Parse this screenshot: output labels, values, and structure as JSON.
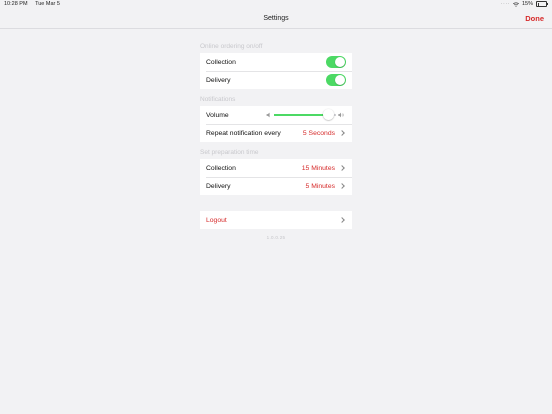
{
  "status_bar": {
    "time": "10:28 PM",
    "date": "Tue Mar 5",
    "battery": "15%"
  },
  "nav": {
    "title": "Settings",
    "done_label": "Done"
  },
  "sections": {
    "ordering": {
      "header": "Online ordering on/off",
      "collection_label": "Collection",
      "collection_on": true,
      "delivery_label": "Delivery",
      "delivery_on": true
    },
    "notifications": {
      "header": "Notifications",
      "volume_label": "Volume",
      "volume_level": 0.88,
      "repeat_label": "Repeat notification every",
      "repeat_value": "5 Seconds"
    },
    "prep": {
      "header": "Set preparation time",
      "collection_label": "Collection",
      "collection_value": "15 Minutes",
      "delivery_label": "Delivery",
      "delivery_value": "5 Minutes"
    },
    "account": {
      "logout_label": "Logout"
    }
  },
  "version": "1.0.0.25",
  "colors": {
    "accent": "#d62b2b",
    "toggle_on": "#4cd964",
    "background": "#f2f2f4"
  },
  "icons": [
    "wifi-icon",
    "battery-icon",
    "speaker-low-icon",
    "speaker-high-icon",
    "chevron-right-icon"
  ]
}
